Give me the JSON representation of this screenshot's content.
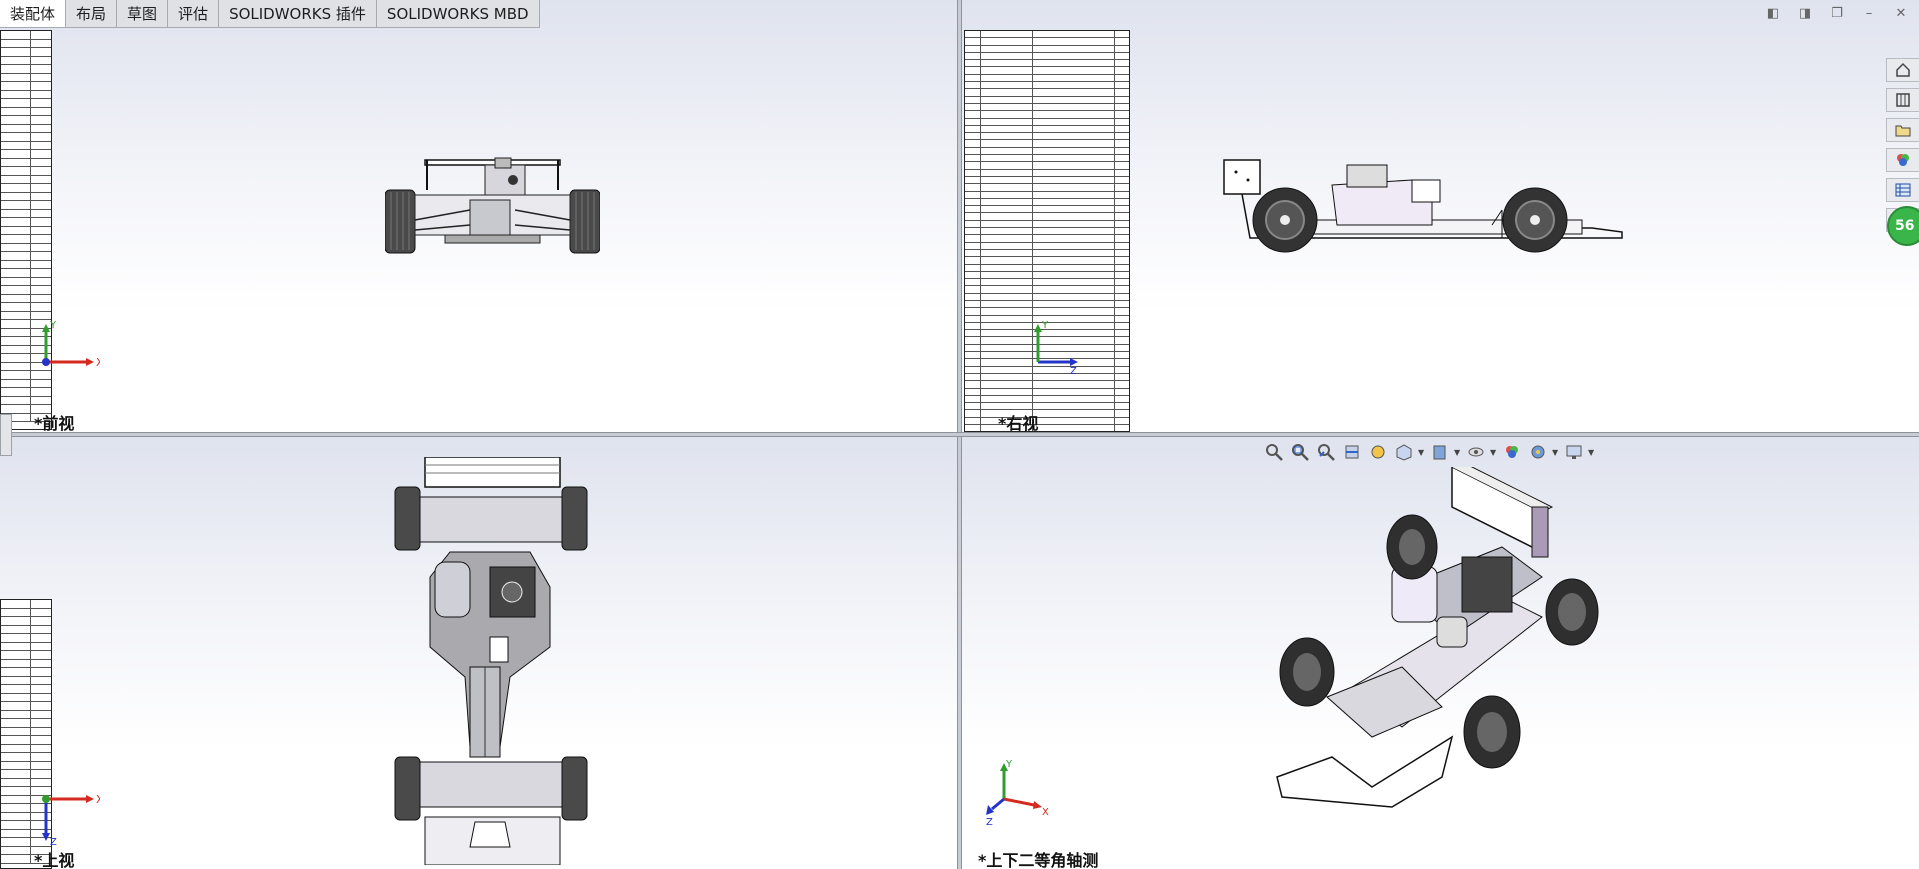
{
  "commandTabs": [
    "装配体",
    "布局",
    "草图",
    "评估",
    "SOLIDWORKS 插件",
    "SOLIDWORKS MBD"
  ],
  "activeTab": "装配体",
  "views": {
    "front": {
      "label": "*前视"
    },
    "right": {
      "label": "*右视"
    },
    "top": {
      "label": "*上视"
    },
    "iso": {
      "label": "*上下二等角轴测"
    }
  },
  "triads": {
    "front": {
      "x": "X",
      "y": "Y"
    },
    "right": {
      "z": "Z",
      "y": "Y"
    },
    "top": {
      "x": "X",
      "z": "Z"
    },
    "iso": {
      "x": "X",
      "y": "Y",
      "z": "Z"
    }
  },
  "taskPane": {
    "badgeValue": "56",
    "icons": [
      "home-icon",
      "3d-library-icon",
      "folder-icon",
      "appearance-icon",
      "custom-properties-icon",
      "forum-icon"
    ]
  },
  "windowControls": [
    "tile-left-icon",
    "tile-right-icon",
    "restore-icon",
    "minimize-icon",
    "close-icon"
  ],
  "hudToolbar": [
    "zoom-to-fit-icon",
    "zoom-area-icon",
    "previous-view-icon",
    "section-view-icon",
    "dynamic-annotation-icon",
    "view-orientation-icon",
    "display-style-icon",
    "hide-show-icon",
    "edit-appearance-icon",
    "apply-scene-icon",
    "view-settings-icon"
  ],
  "colors": {
    "viewportTop": "#dfe3ee",
    "viewportBottom": "#ffffff",
    "axisX": "#d42a1f",
    "axisY": "#2f9e2f",
    "axisZ": "#2534c8",
    "badge": "#39b54a"
  },
  "bomRowsTopRight": 57,
  "bomRowsLeft": 46
}
